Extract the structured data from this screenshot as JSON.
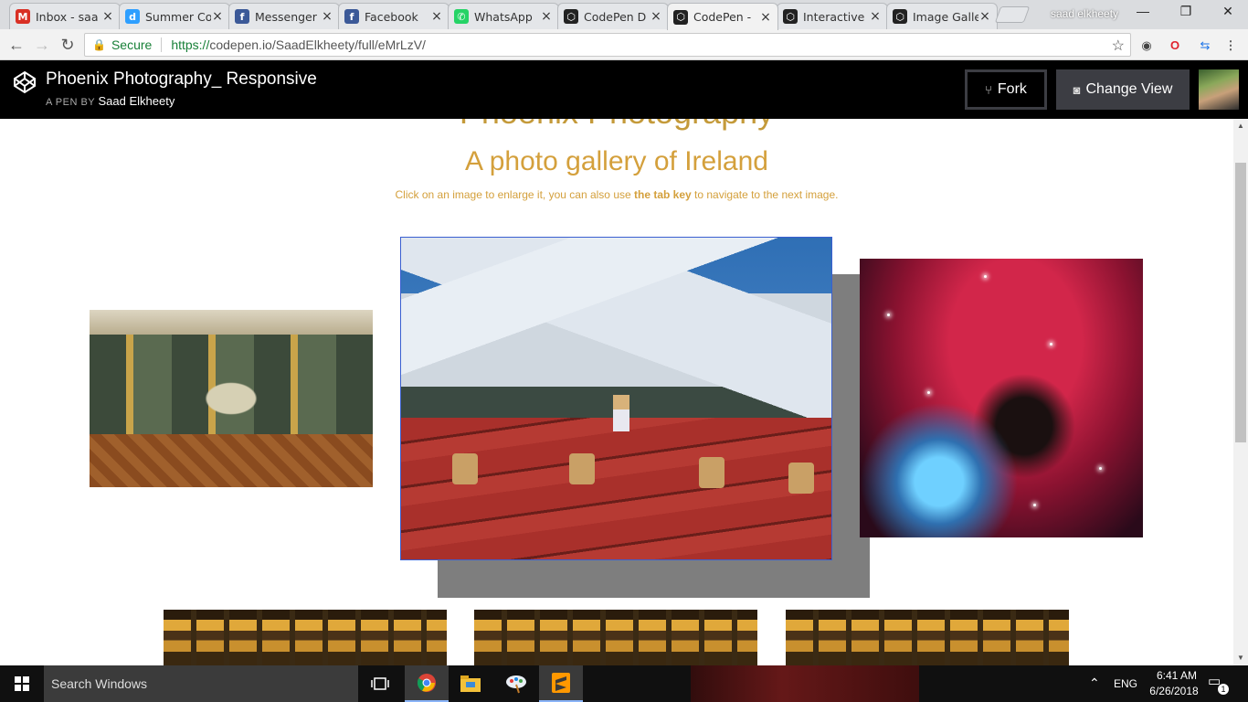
{
  "browser": {
    "tabs": [
      {
        "title": "Inbox - saa",
        "icon": "gmail-icon",
        "color": "#d93025",
        "glyph": "M"
      },
      {
        "title": "Summer Co",
        "icon": "disqus-icon",
        "color": "#2e9fff",
        "glyph": "d"
      },
      {
        "title": "Messenger",
        "icon": "facebook-icon",
        "color": "#3b5998",
        "glyph": "f"
      },
      {
        "title": "Facebook",
        "icon": "facebook-icon",
        "color": "#3b5998",
        "glyph": "f"
      },
      {
        "title": "WhatsApp",
        "icon": "whatsapp-icon",
        "color": "#25d366",
        "glyph": "✆"
      },
      {
        "title": "CodePen D",
        "icon": "codepen-icon",
        "color": "#222222",
        "glyph": "⬡"
      },
      {
        "title": "CodePen -",
        "icon": "codepen-icon",
        "color": "#222222",
        "glyph": "⬡"
      },
      {
        "title": "Interactive",
        "icon": "codepen-icon",
        "color": "#222222",
        "glyph": "⬡"
      },
      {
        "title": "Image Galle",
        "icon": "codepen-icon",
        "color": "#222222",
        "glyph": "⬡"
      }
    ],
    "active_tab_index": 6,
    "profile_name": "saad elkheety",
    "window_controls": {
      "minimize": "—",
      "maximize": "❐",
      "close": "✕"
    },
    "secure_label": "Secure",
    "url_scheme": "https://",
    "url_rest": "codepen.io/SaadElkheety/full/eMrLzV/"
  },
  "codepen": {
    "title": "Phoenix Photography_ Responsive",
    "byline_prefix": "A PEN BY",
    "author": "Saad Elkheety",
    "fork_label": "Fork",
    "change_view_label": "Change View"
  },
  "page": {
    "clipped_heading": "Phoenix Photography",
    "gallery_title": "A photo gallery of Ireland",
    "subtitle_before": "Click on an image to enlarge it, you can also use ",
    "subtitle_bold": "the tab key",
    "subtitle_after": " to navigate to the next image."
  },
  "taskbar": {
    "search_placeholder": "Search Windows",
    "language": "ENG",
    "time": "6:41 AM",
    "date": "6/26/2018",
    "notification_count": "1"
  }
}
